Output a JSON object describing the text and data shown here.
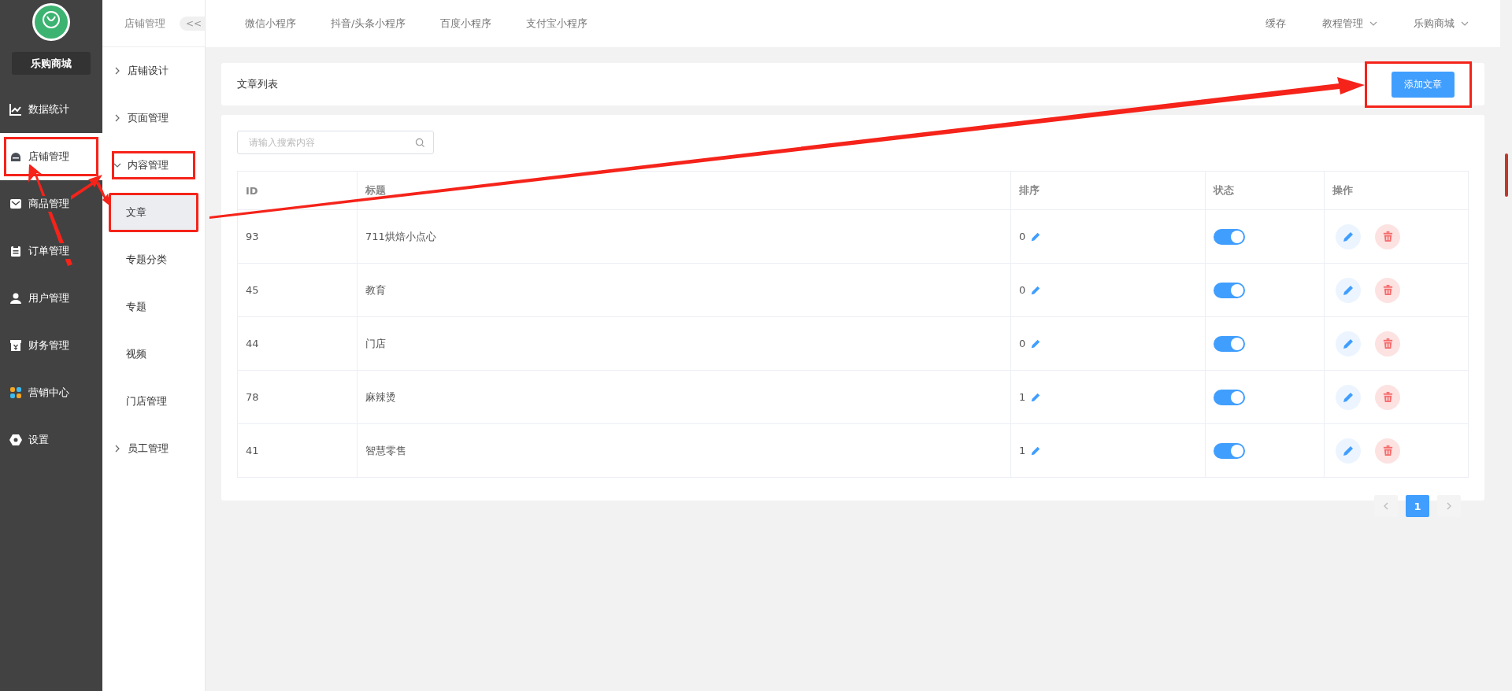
{
  "sidebar": {
    "shop_name": "乐购商城",
    "items": [
      {
        "label": "数据统计",
        "selected": false,
        "annotated": false
      },
      {
        "label": "店铺管理",
        "selected": true,
        "annotated": true
      },
      {
        "label": "商品管理",
        "selected": false,
        "annotated": false
      },
      {
        "label": "订单管理",
        "selected": false,
        "annotated": false
      },
      {
        "label": "用户管理",
        "selected": false,
        "annotated": false
      },
      {
        "label": "财务管理",
        "selected": false,
        "annotated": false
      },
      {
        "label": "营销中心",
        "selected": false,
        "annotated": false
      },
      {
        "label": "设置",
        "selected": false,
        "annotated": false
      }
    ]
  },
  "submenu": {
    "title": "店铺管理",
    "collapse": "<<",
    "groups": [
      {
        "label": "店铺设计",
        "expanded": false,
        "annotated": false
      },
      {
        "label": "页面管理",
        "expanded": false,
        "annotated": false
      },
      {
        "label": "内容管理",
        "expanded": true,
        "annotated": true,
        "children": [
          {
            "label": "文章",
            "selected": true,
            "annotated": true
          },
          {
            "label": "专题分类",
            "selected": false,
            "annotated": false
          },
          {
            "label": "专题",
            "selected": false,
            "annotated": false
          },
          {
            "label": "视频",
            "selected": false,
            "annotated": false
          },
          {
            "label": "门店管理",
            "selected": false,
            "annotated": false
          }
        ]
      },
      {
        "label": "员工管理",
        "expanded": false,
        "annotated": false
      }
    ]
  },
  "top_nav": {
    "tabs": [
      "微信小程序",
      "抖音/头条小程序",
      "百度小程序",
      "支付宝小程序"
    ],
    "right": [
      {
        "label": "缓存",
        "dropdown": false
      },
      {
        "label": "教程管理",
        "dropdown": true
      },
      {
        "label": "乐购商城",
        "dropdown": true
      }
    ]
  },
  "card_title": "文章列表",
  "add_button": {
    "label": "添加文章",
    "annotated": true
  },
  "search": {
    "placeholder": "请输入搜索内容"
  },
  "table": {
    "columns": [
      "ID",
      "标题",
      "排序",
      "状态",
      "操作"
    ],
    "rows": [
      {
        "id": "93",
        "title": "711烘焙小点心",
        "sort": "0",
        "on": true
      },
      {
        "id": "45",
        "title": "教育",
        "sort": "0",
        "on": true
      },
      {
        "id": "44",
        "title": "门店",
        "sort": "0",
        "on": true
      },
      {
        "id": "78",
        "title": "麻辣烫",
        "sort": "1",
        "on": true
      },
      {
        "id": "41",
        "title": "智慧零售",
        "sort": "1",
        "on": true
      }
    ]
  },
  "pagination": {
    "pages": [
      {
        "label": "1",
        "selected": true
      }
    ]
  }
}
